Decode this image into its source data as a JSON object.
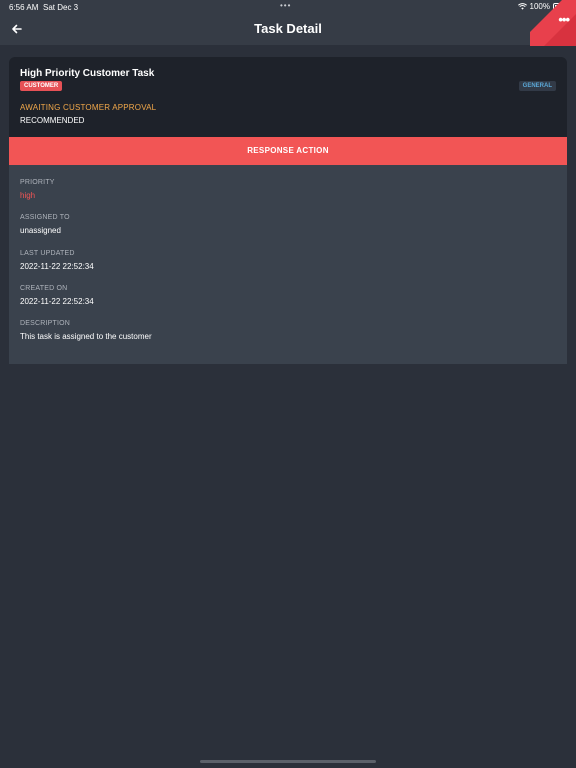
{
  "status_bar": {
    "time": "6:56 AM",
    "date": "Sat Dec 3",
    "battery": "100%"
  },
  "nav": {
    "title": "Task Detail",
    "back_icon": "arrow-left-icon",
    "more_icon": "more-icon"
  },
  "task": {
    "title": "High Priority Customer Task",
    "type_badge": "CUSTOMER",
    "category_badge": "GENERAL",
    "status": "AWAITING CUSTOMER APPROVAL",
    "recommendation": "RECOMMENDED",
    "action_label": "RESPONSE ACTION"
  },
  "fields": [
    {
      "label": "PRIORITY",
      "value": "high"
    },
    {
      "label": "ASSIGNED TO",
      "value": "unassigned"
    },
    {
      "label": "LAST UPDATED",
      "value": "2022-11-22 22:52:34"
    },
    {
      "label": "CREATED ON",
      "value": "2022-11-22 22:52:34"
    },
    {
      "label": "DESCRIPTION",
      "value": "This task is assigned to the customer"
    }
  ],
  "colors": {
    "background": "#2b303a",
    "header": "#363c46",
    "accent_red": "#f25555",
    "status_orange": "#f2a84a",
    "general_badge_text": "#5aa7d6"
  }
}
